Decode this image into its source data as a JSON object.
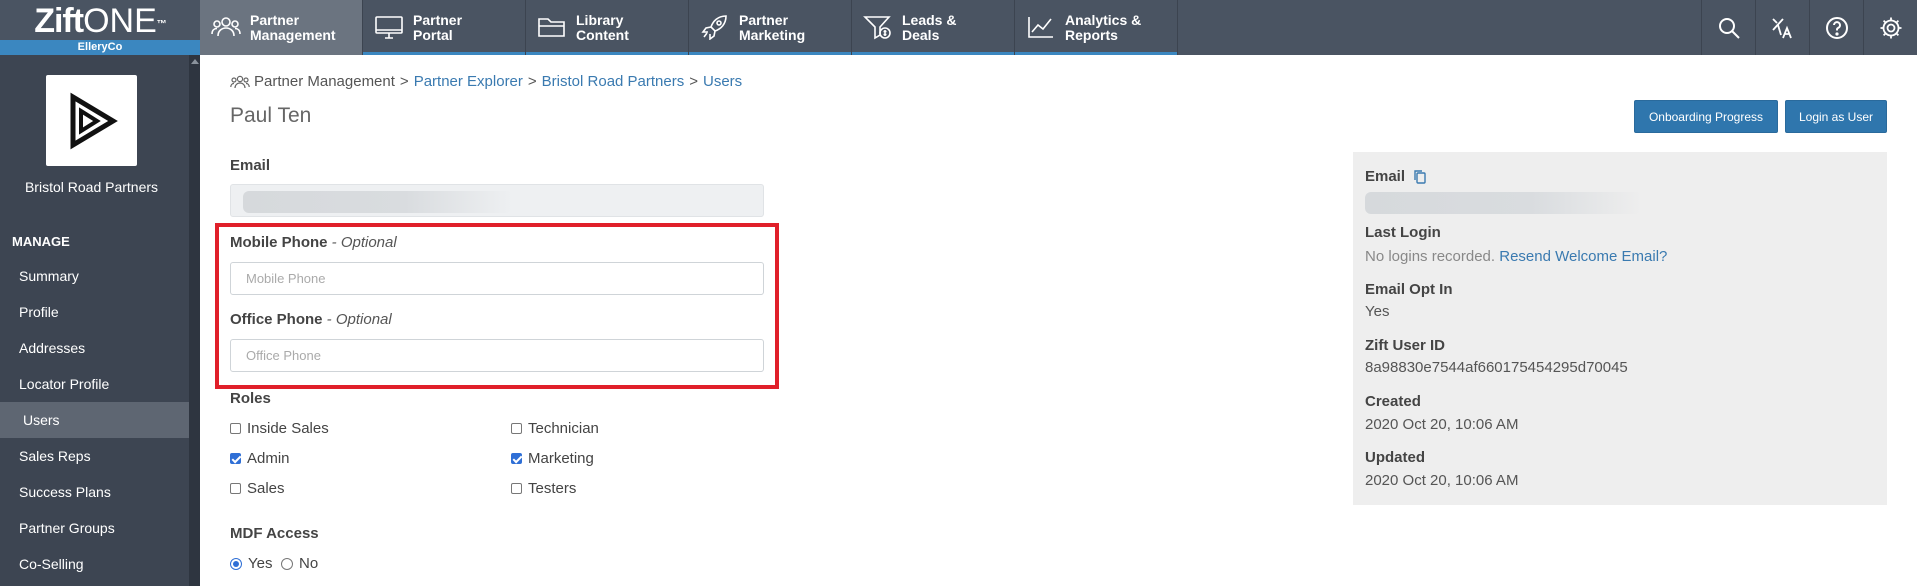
{
  "brand": {
    "logo_bold": "Zift",
    "logo_light": "ONE",
    "logo_tm": "™",
    "org": "ElleryCo"
  },
  "nav": [
    {
      "label": "Partner\nManagement",
      "icon": "people-icon"
    },
    {
      "label": "Partner\nPortal",
      "icon": "monitor-icon"
    },
    {
      "label": "Library\nContent",
      "icon": "folder-icon"
    },
    {
      "label": "Partner\nMarketing",
      "icon": "rocket-icon"
    },
    {
      "label": "Leads &\nDeals",
      "icon": "funnel-dollar-icon"
    },
    {
      "label": "Analytics &\nReports",
      "icon": "line-chart-icon"
    }
  ],
  "tools": [
    "search-icon",
    "translate-icon",
    "help-icon",
    "gear-icon"
  ],
  "sidebar": {
    "partner_name": "Bristol Road Partners",
    "section": "MANAGE",
    "items": [
      "Summary",
      "Profile",
      "Addresses",
      "Locator Profile",
      "Users",
      "Sales Reps",
      "Success Plans",
      "Partner Groups",
      "Co-Selling"
    ],
    "active_item": "Users"
  },
  "breadcrumb": {
    "root": "Partner Management",
    "sep": ">",
    "l1": "Partner Explorer",
    "l2": "Bristol Road Partners",
    "l3": "Users"
  },
  "page_title": "Paul Ten",
  "buttons": {
    "onboarding": "Onboarding Progress",
    "login_as": "Login as User"
  },
  "form": {
    "email_label": "Email",
    "mobile_label": "Mobile Phone",
    "mobile_optional": " - Optional",
    "mobile_placeholder": "Mobile Phone",
    "office_label": "Office Phone",
    "office_optional": " - Optional",
    "office_placeholder": "Office Phone",
    "roles_label": "Roles",
    "roles": [
      {
        "label": "Inside Sales",
        "checked": false
      },
      {
        "label": "Technician",
        "checked": false
      },
      {
        "label": "Admin",
        "checked": true
      },
      {
        "label": "Marketing",
        "checked": true
      },
      {
        "label": "Sales",
        "checked": false
      },
      {
        "label": "Testers",
        "checked": false
      }
    ],
    "mdf_label": "MDF Access",
    "mdf_yes": "Yes",
    "mdf_no": "No",
    "mdf_selected": "Yes"
  },
  "info": {
    "email_label": "Email",
    "last_login_label": "Last Login",
    "last_login_value": "No logins recorded.",
    "resend_link": "Resend Welcome Email?",
    "optin_label": "Email Opt In",
    "optin_value": "Yes",
    "userid_label": "Zift User ID",
    "userid_value": "8a98830e7544af660175454295d70045",
    "created_label": "Created",
    "created_value": "2020 Oct 20, 10:06 AM",
    "updated_label": "Updated",
    "updated_value": "2020 Oct 20, 10:06 AM"
  },
  "colors": {
    "accent": "#3b87c0",
    "nav_bg": "#4a5462",
    "sidebar_bg": "#3d4552",
    "highlight": "#e0202a",
    "button": "#2f76ad"
  }
}
